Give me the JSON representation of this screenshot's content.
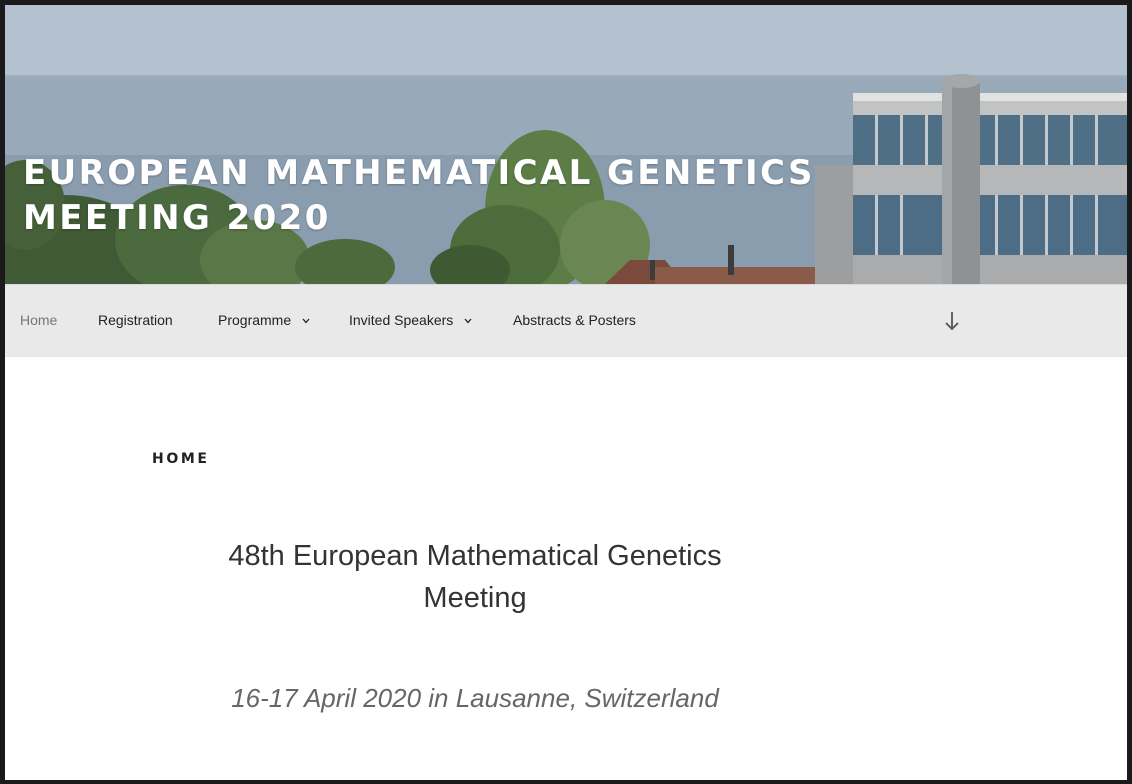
{
  "site": {
    "title": "EUROPEAN MATHEMATICAL GENETICS MEETING 2020"
  },
  "nav": {
    "items": [
      {
        "label": "Home",
        "current": true,
        "has_dropdown": false
      },
      {
        "label": "Registration",
        "current": false,
        "has_dropdown": false
      },
      {
        "label": "Programme",
        "current": false,
        "has_dropdown": true
      },
      {
        "label": "Invited Speakers",
        "current": false,
        "has_dropdown": true
      },
      {
        "label": "Abstracts & Posters",
        "current": false,
        "has_dropdown": false
      }
    ],
    "scroll_icon": "arrow-down-icon"
  },
  "content": {
    "page_title": "HOME",
    "headline": "48th European Mathematical Genetics Meeting",
    "subhead": "16-17 April 2020 in Lausanne, Switzerland"
  },
  "colors": {
    "nav_background": "#e9e9e9",
    "nav_current": "#767676",
    "nav_text": "#222222",
    "title_text": "#ffffff",
    "subhead_text": "#666666"
  }
}
